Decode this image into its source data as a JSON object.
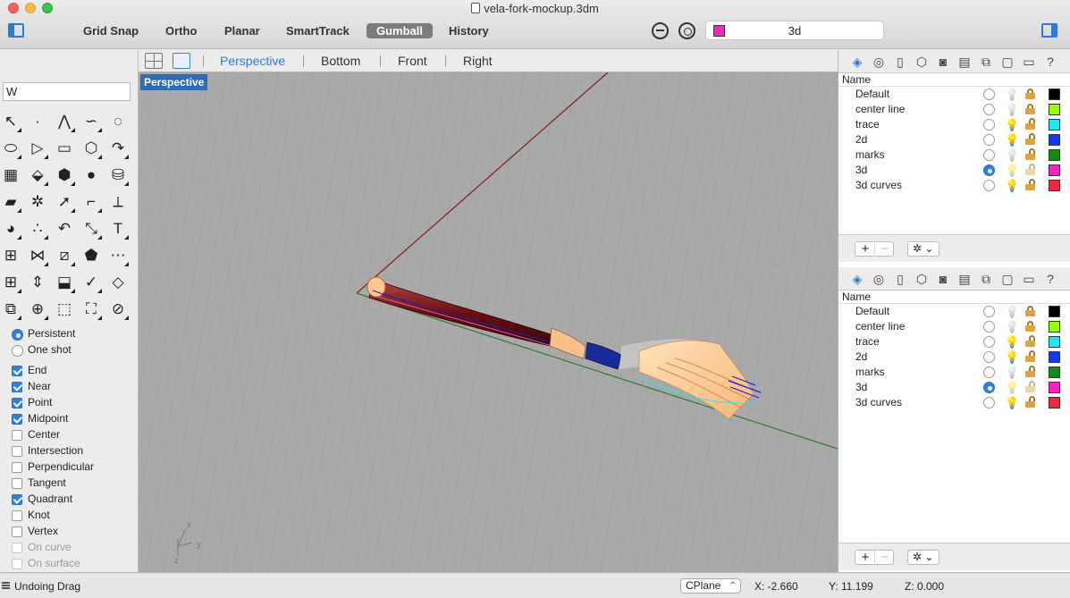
{
  "window": {
    "title": "vela-fork-mockup.3dm"
  },
  "toolbar": {
    "buttons": [
      {
        "label": "Grid Snap",
        "active": false
      },
      {
        "label": "Ortho",
        "active": false
      },
      {
        "label": "Planar",
        "active": false
      },
      {
        "label": "SmartTrack",
        "active": false
      },
      {
        "label": "Gumball",
        "active": true
      },
      {
        "label": "History",
        "active": false
      }
    ],
    "current_layer": {
      "name": "3d",
      "color": "#ff20c8"
    }
  },
  "command": {
    "input_value": "W"
  },
  "tools": [
    "select-arrow-icon",
    "point-icon",
    "polyline-icon",
    "curve-icon",
    "circle-icon",
    "ellipse-icon",
    "arc-icon",
    "rectangle-icon",
    "polygon-icon",
    "fillet-curve-icon",
    "surface-icon",
    "loft-icon",
    "box-icon",
    "sphere-icon",
    "cylinder-icon",
    "extrude-icon",
    "gear-icon",
    "explode-icon",
    "trim-icon",
    "split-icon",
    "boolean-icon",
    "group-icon",
    "rotate-icon",
    "scale-icon",
    "text-icon",
    "array-icon",
    "network-icon",
    "paint-icon",
    "solid-edit-icon",
    "dimension-icon",
    "grid-array-icon",
    "align-icon",
    "gumball-icon",
    "check-icon",
    "analyze-icon",
    "mesh-icon",
    "zoom-icon",
    "zoom-window-icon",
    "zoom-extents-icon",
    "zoom-selected-icon"
  ],
  "osnap": {
    "mode": [
      {
        "label": "Persistent",
        "selected": true
      },
      {
        "label": "One shot",
        "selected": false
      }
    ],
    "snaps": [
      {
        "label": "End",
        "checked": true,
        "enabled": true
      },
      {
        "label": "Near",
        "checked": true,
        "enabled": true
      },
      {
        "label": "Point",
        "checked": true,
        "enabled": true
      },
      {
        "label": "Midpoint",
        "checked": true,
        "enabled": true
      },
      {
        "label": "Center",
        "checked": false,
        "enabled": true
      },
      {
        "label": "Intersection",
        "checked": false,
        "enabled": true
      },
      {
        "label": "Perpendicular",
        "checked": false,
        "enabled": true
      },
      {
        "label": "Tangent",
        "checked": false,
        "enabled": true
      },
      {
        "label": "Quadrant",
        "checked": true,
        "enabled": true
      },
      {
        "label": "Knot",
        "checked": false,
        "enabled": true
      },
      {
        "label": "Vertex",
        "checked": false,
        "enabled": true
      },
      {
        "label": "On curve",
        "checked": false,
        "enabled": false
      },
      {
        "label": "On surface",
        "checked": false,
        "enabled": false
      }
    ]
  },
  "viewports": {
    "tabs": [
      "Perspective",
      "Bottom",
      "Front",
      "Right"
    ],
    "active_tab": "Perspective",
    "active_label": "Perspective",
    "axes": {
      "x": "x",
      "y": "y",
      "z": "z"
    }
  },
  "layers_header": "Name",
  "layers": [
    {
      "name": "Default",
      "current": false,
      "bulb_on": false,
      "locked": true,
      "color": "#000000"
    },
    {
      "name": "center line",
      "current": false,
      "bulb_on": false,
      "locked": true,
      "color": "#99ff00"
    },
    {
      "name": "trace",
      "current": false,
      "bulb_on": true,
      "locked": false,
      "color": "#22e6f0"
    },
    {
      "name": "2d",
      "current": false,
      "bulb_on": true,
      "locked": false,
      "color": "#1436f5"
    },
    {
      "name": "marks",
      "current": false,
      "bulb_on": false,
      "locked": false,
      "color": "#138a16"
    },
    {
      "name": "3d",
      "current": true,
      "bulb_on": true,
      "locked": false,
      "color": "#ff20c8"
    },
    {
      "name": "3d curves",
      "current": false,
      "bulb_on": true,
      "locked": false,
      "color": "#f0283c"
    }
  ],
  "layer_panel_buttons": {
    "add": "+",
    "remove": "−",
    "gear": "✲ ⌄"
  },
  "status": {
    "message": "Undoing Drag",
    "cplane": "CPlane",
    "x": "X: -2.660",
    "y": "Y: 11.199",
    "z": "Z: 0.000"
  }
}
